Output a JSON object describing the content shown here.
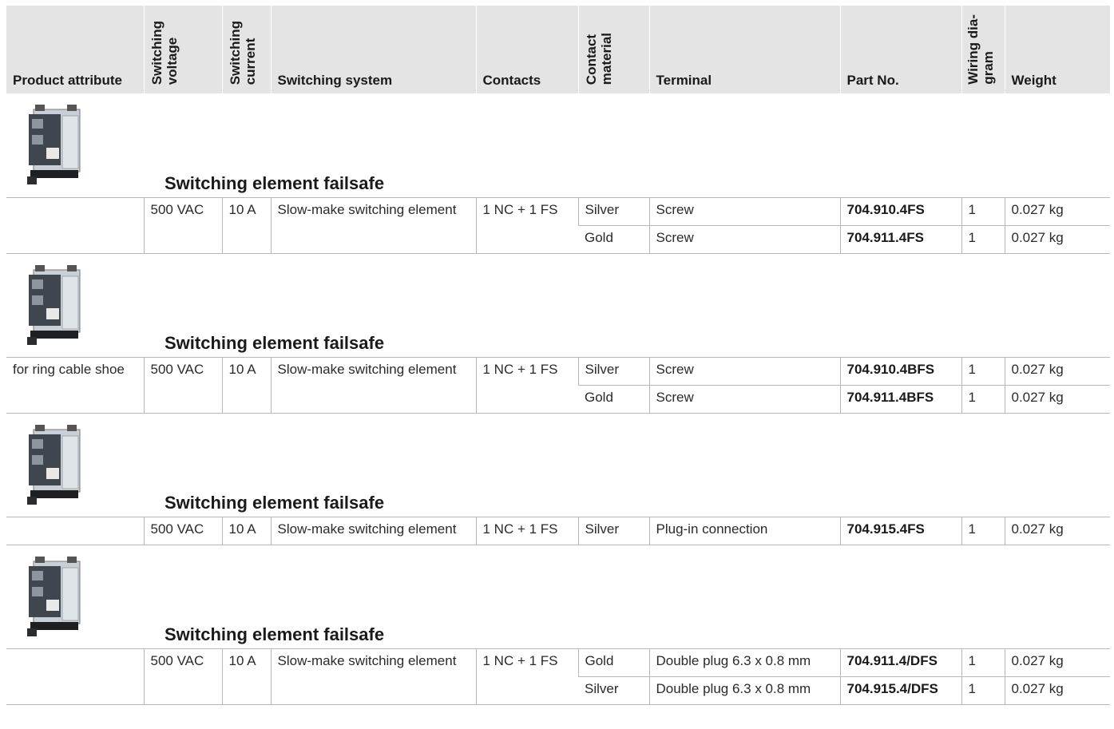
{
  "headers": {
    "product_attribute": "Product attribute",
    "switching_voltage": "Switching\nvoltage",
    "switching_current": "Switching\ncurrent",
    "switching_system": "Switching system",
    "contacts": "Contacts",
    "contact_material": "Contact\nmaterial",
    "terminal": "Terminal",
    "part_no": "Part No.",
    "wiring_diagram": "Wiring dia-\ngram",
    "weight": "Weight"
  },
  "groups": [
    {
      "title": "Switching element failsafe",
      "attribute": "",
      "voltage": "500 VAC",
      "current": "10 A",
      "system": "Slow-make switching element",
      "contacts": "1 NC + 1 FS",
      "rows": [
        {
          "material": "Silver",
          "terminal": "Screw",
          "part_no": "704.910.4FS",
          "wiring": "1",
          "weight": "0.027 kg"
        },
        {
          "material": "Gold",
          "terminal": "Screw",
          "part_no": "704.911.4FS",
          "wiring": "1",
          "weight": "0.027 kg"
        }
      ]
    },
    {
      "title": "Switching element failsafe",
      "attribute": "for ring cable shoe",
      "voltage": "500 VAC",
      "current": "10 A",
      "system": "Slow-make switching element",
      "contacts": "1 NC + 1 FS",
      "rows": [
        {
          "material": "Silver",
          "terminal": "Screw",
          "part_no": "704.910.4BFS",
          "wiring": "1",
          "weight": "0.027 kg"
        },
        {
          "material": "Gold",
          "terminal": "Screw",
          "part_no": "704.911.4BFS",
          "wiring": "1",
          "weight": "0.027 kg"
        }
      ]
    },
    {
      "title": "Switching element failsafe",
      "attribute": "",
      "voltage": "500 VAC",
      "current": "10 A",
      "system": "Slow-make switching element",
      "contacts": "1 NC + 1 FS",
      "rows": [
        {
          "material": "Silver",
          "terminal": "Plug-in connection",
          "part_no": "704.915.4FS",
          "wiring": "1",
          "weight": "0.027 kg"
        }
      ]
    },
    {
      "title": "Switching element failsafe",
      "attribute": "",
      "voltage": "500 VAC",
      "current": "10 A",
      "system": "Slow-make switching element",
      "contacts": "1 NC + 1 FS",
      "rows": [
        {
          "material": "Gold",
          "terminal": "Double plug 6.3 x 0.8 mm",
          "part_no": "704.911.4/DFS",
          "wiring": "1",
          "weight": "0.027 kg"
        },
        {
          "material": "Silver",
          "terminal": "Double plug 6.3 x 0.8 mm",
          "part_no": "704.915.4/DFS",
          "wiring": "1",
          "weight": "0.027 kg"
        }
      ]
    }
  ]
}
